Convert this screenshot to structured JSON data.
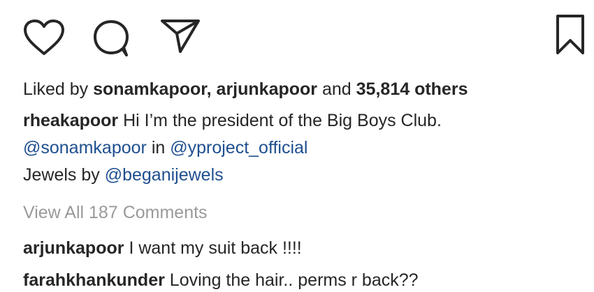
{
  "actions": {
    "icons": [
      "heart-icon",
      "comment-icon",
      "share-icon",
      "bookmark-icon"
    ]
  },
  "likes": {
    "prefix": "Liked by",
    "user1": "sonamkapoor",
    "separator": ",",
    "user2": "arjunkapoor",
    "and": "and",
    "count": "35,814 others"
  },
  "caption": {
    "username": "rheakapoor",
    "line1": "Hi I’m the president of the Big Boys Club.",
    "mention1": "@sonamkapoor",
    "in": "in",
    "mention2": "@yproject_official",
    "jewels_prefix": "Jewels by",
    "mention3": "@beganijewels"
  },
  "view_all": "View All 187 Comments",
  "comments": [
    {
      "username": "arjunkapoor",
      "text": "I want my suit back !!!!"
    },
    {
      "username": "farahkhankunder",
      "text": "Loving the hair.. perms r back??"
    }
  ],
  "colors": {
    "text": "#262626",
    "mention": "#1f4f8f",
    "muted": "#9a9a9a"
  }
}
